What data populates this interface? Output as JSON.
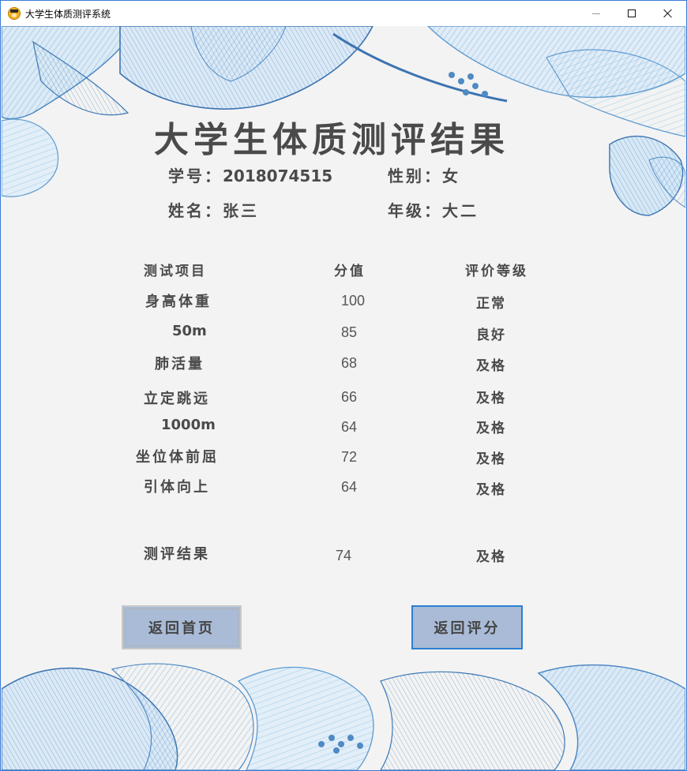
{
  "window": {
    "title": "大学生体质测评系统",
    "icon": "student-avatar-icon",
    "controls": [
      "minimize-icon",
      "maximize-icon",
      "close-icon"
    ]
  },
  "page": {
    "heading": "大学生体质测评结果",
    "student": {
      "id_label": "学号：",
      "id_value": "2018074515",
      "gender_label": "性别：",
      "gender_value": "女",
      "name_label": "姓名：",
      "name_value": "张三",
      "grade_label": "年级：",
      "grade_value": "大二"
    },
    "table": {
      "headers": [
        "测试项目",
        "分值",
        "评价等级"
      ],
      "rows": [
        {
          "item": "身高体重",
          "score": "100",
          "level": "正常"
        },
        {
          "item": "50m",
          "score": "85",
          "level": "良好"
        },
        {
          "item": "肺活量",
          "score": "68",
          "level": "及格"
        },
        {
          "item": "立定跳远",
          "score": "66",
          "level": "及格"
        },
        {
          "item": "1000m",
          "score": "64",
          "level": "及格"
        },
        {
          "item": "坐位体前屈",
          "score": "72",
          "level": "及格"
        },
        {
          "item": "引体向上",
          "score": "64",
          "level": "及格"
        }
      ],
      "total": {
        "item": "测评结果",
        "score": "74",
        "level": "及格"
      }
    },
    "buttons": {
      "home": "返回首页",
      "back_to_scoring": "返回评分"
    }
  },
  "colors": {
    "background": "#f3f3f3",
    "text": "#4a4a4a",
    "button_fill": "#a9bbd6",
    "button_focus_border": "#2d7fd3",
    "floral_blue": "#5a9fd0"
  }
}
